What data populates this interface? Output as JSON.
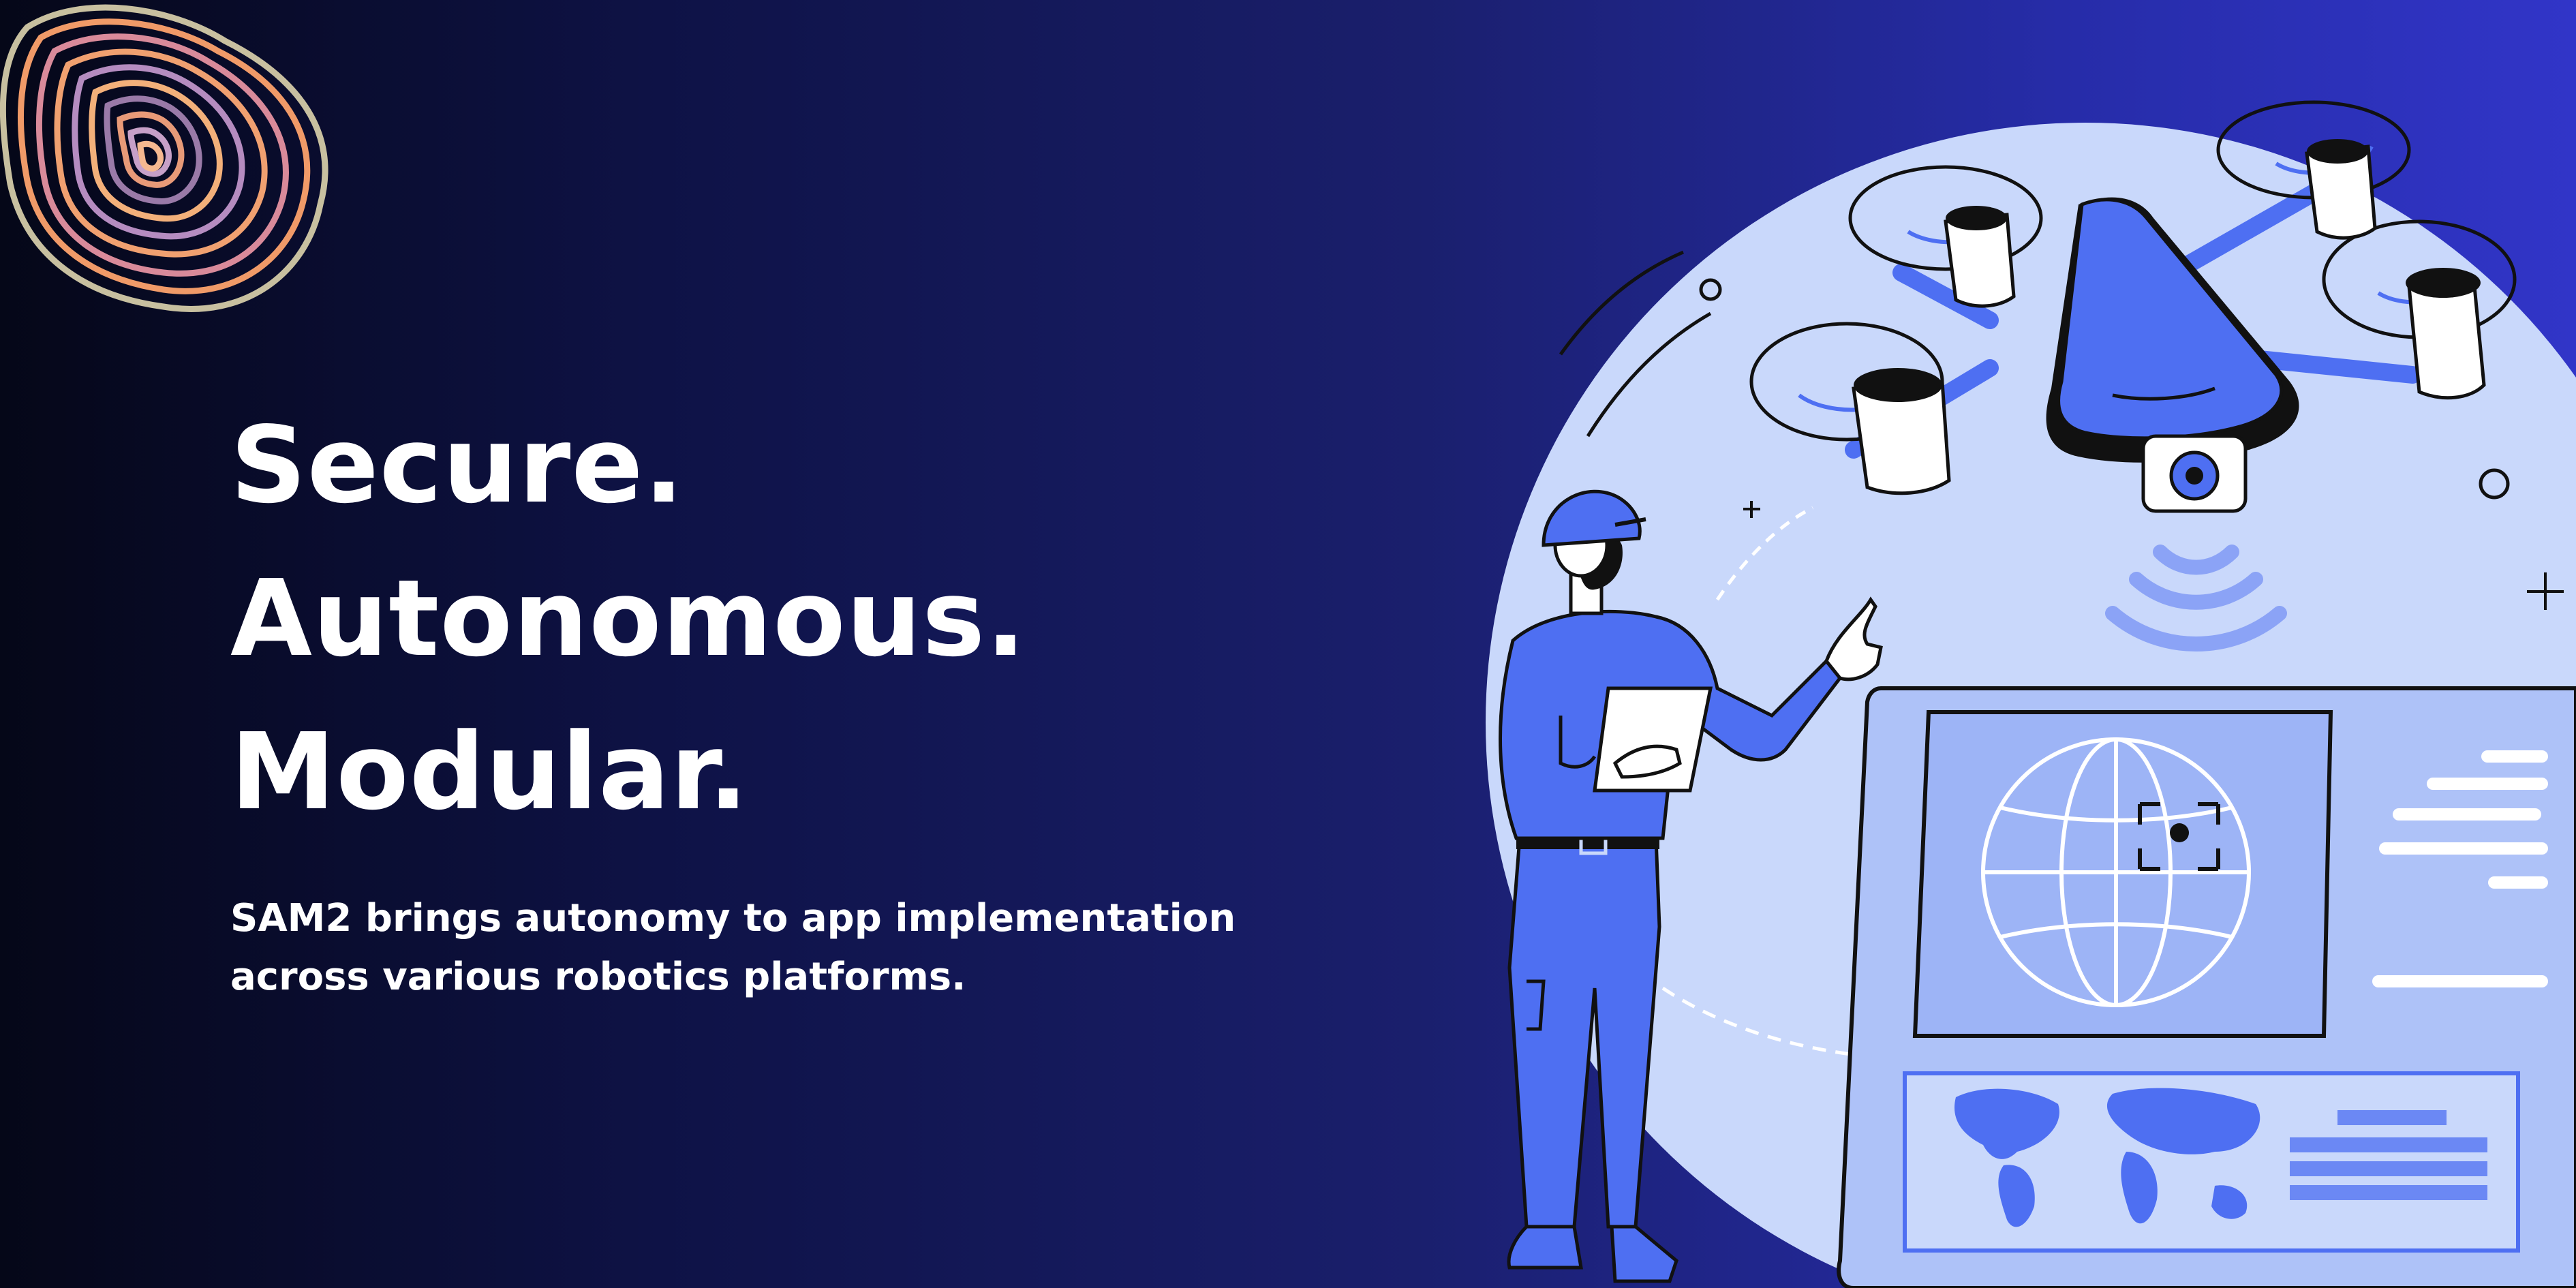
{
  "headline": {
    "line1": "Secure.",
    "line2": "Autonomous.",
    "line3": "Modular."
  },
  "tagline": {
    "line1": "SAM2 brings autonomy to app implementation",
    "line2": "across various robotics platforms."
  },
  "icons": {
    "logo": "topographic-rings-logo",
    "illustration": "engineer-controlling-drone-illustration",
    "drone": "quadcopter-drone-icon",
    "globe": "globe-icon",
    "world_map": "world-map-icon"
  },
  "colors": {
    "bg_dark": "#050718",
    "bg_mid": "#1a1f6d",
    "bg_right": "#3135c8",
    "accent_blue": "#4e6ff2",
    "pale_blue": "#c9d8fb",
    "text": "#ffffff"
  }
}
